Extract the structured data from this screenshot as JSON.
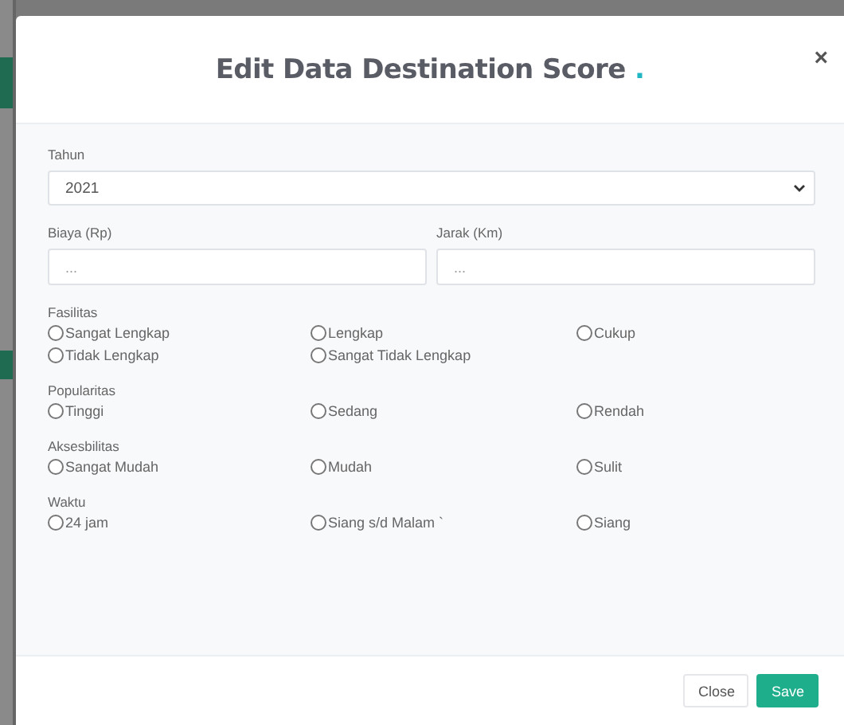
{
  "modal": {
    "title": "Edit Data Destination Score",
    "title_accent": ".",
    "close_icon": "×"
  },
  "fields": [
    {
      "kind": "select",
      "label": "Tahun",
      "value": "2021"
    },
    {
      "kind": "pair",
      "items": [
        {
          "label": "Biaya (Rp)",
          "placeholder": "..."
        },
        {
          "label": "Jarak (Km)",
          "placeholder": "..."
        }
      ]
    }
  ],
  "radio_groups": [
    {
      "label": "Fasilitas",
      "options": [
        {
          "label": "Sangat Lengkap",
          "selected": false
        },
        {
          "label": "Lengkap",
          "selected": false
        },
        {
          "label": "Cukup",
          "selected": false
        },
        {
          "label": "Tidak Lengkap",
          "selected": false
        },
        {
          "label": "Sangat Tidak Lengkap",
          "selected": false
        }
      ]
    },
    {
      "label": "Popularitas",
      "options": [
        {
          "label": "Tinggi",
          "selected": false
        },
        {
          "label": "Sedang",
          "selected": false
        },
        {
          "label": "Rendah",
          "selected": false
        }
      ]
    },
    {
      "label": "Aksesbilitas",
      "options": [
        {
          "label": "Sangat Mudah",
          "selected": false
        },
        {
          "label": "Mudah",
          "selected": false
        },
        {
          "label": "Sulit",
          "selected": false
        }
      ]
    },
    {
      "label": "Waktu",
      "options": [
        {
          "label": "24 jam",
          "selected": false
        },
        {
          "label": "Siang s/d Malam `",
          "selected": false
        },
        {
          "label": "Siang",
          "selected": false
        }
      ]
    }
  ],
  "buttons": [
    {
      "kind": "secondary",
      "label": "Close"
    },
    {
      "kind": "primary",
      "label": "Save"
    }
  ]
}
